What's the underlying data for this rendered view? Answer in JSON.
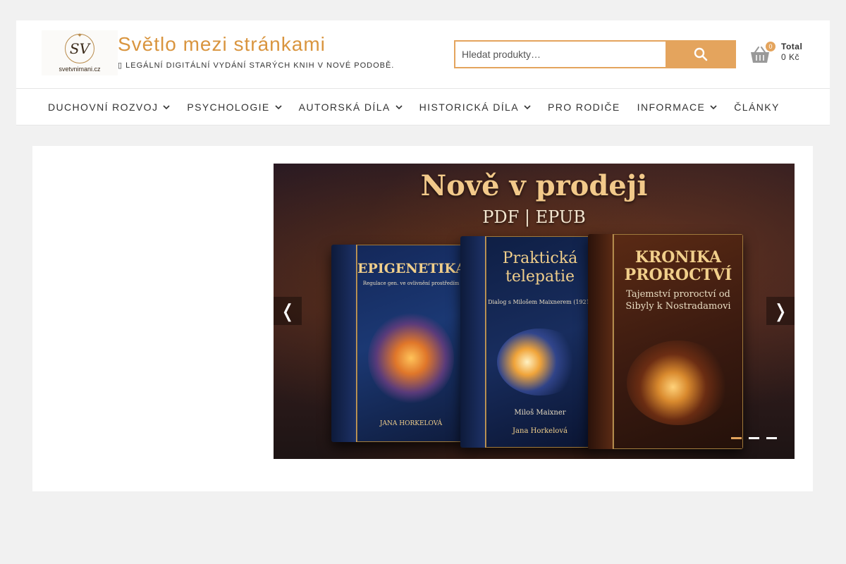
{
  "header": {
    "logo_text": "svetvnimani.cz",
    "logo_monogram": "SV",
    "site_title": "Světlo mezi stránkami",
    "site_description": "▯ LEGÁLNÍ DIGITÁLNÍ VYDÁNÍ STARÝCH KNIH V NOVÉ PODOBĚ."
  },
  "search": {
    "placeholder": "Hledat produkty…",
    "button_icon": "search-icon"
  },
  "cart": {
    "icon": "basket-icon",
    "count": "0",
    "total_label": "Total",
    "total_value": "0 Kč"
  },
  "nav": {
    "items": [
      {
        "label": "DUCHOVNÍ ROZVOJ",
        "dropdown": true
      },
      {
        "label": "PSYCHOLOGIE",
        "dropdown": true
      },
      {
        "label": "AUTORSKÁ DÍLA",
        "dropdown": true
      },
      {
        "label": "HISTORICKÁ DÍLA",
        "dropdown": true
      },
      {
        "label": "PRO RODIČE",
        "dropdown": false
      },
      {
        "label": "INFORMACE",
        "dropdown": true
      },
      {
        "label": "ČLÁNKY",
        "dropdown": false
      }
    ]
  },
  "slider": {
    "title": "Nově v prodeji",
    "subtitle": "PDF | EPUB",
    "prev_label": "❬",
    "next_label": "❭",
    "books": [
      {
        "title": "EPIGENETIKA",
        "subtitle": "Regulace gen. ve ovlivnění prostředím",
        "author": "JANA HORKELOVÁ"
      },
      {
        "title": "Praktická telepatie",
        "subtitle": "Dialog s Milošem Maixnerem (1921)",
        "author_top": "Miloš Maixner",
        "author": "Jana Horkelová"
      },
      {
        "title": "KRONIKA PROROCTVÍ",
        "subtitle": "Tajemství proroctví od Sibyly k Nostradamovi",
        "author": ""
      }
    ],
    "dots": 3,
    "active_dot": 0
  },
  "colors": {
    "accent": "#e4a45d",
    "title": "#d9953f"
  }
}
